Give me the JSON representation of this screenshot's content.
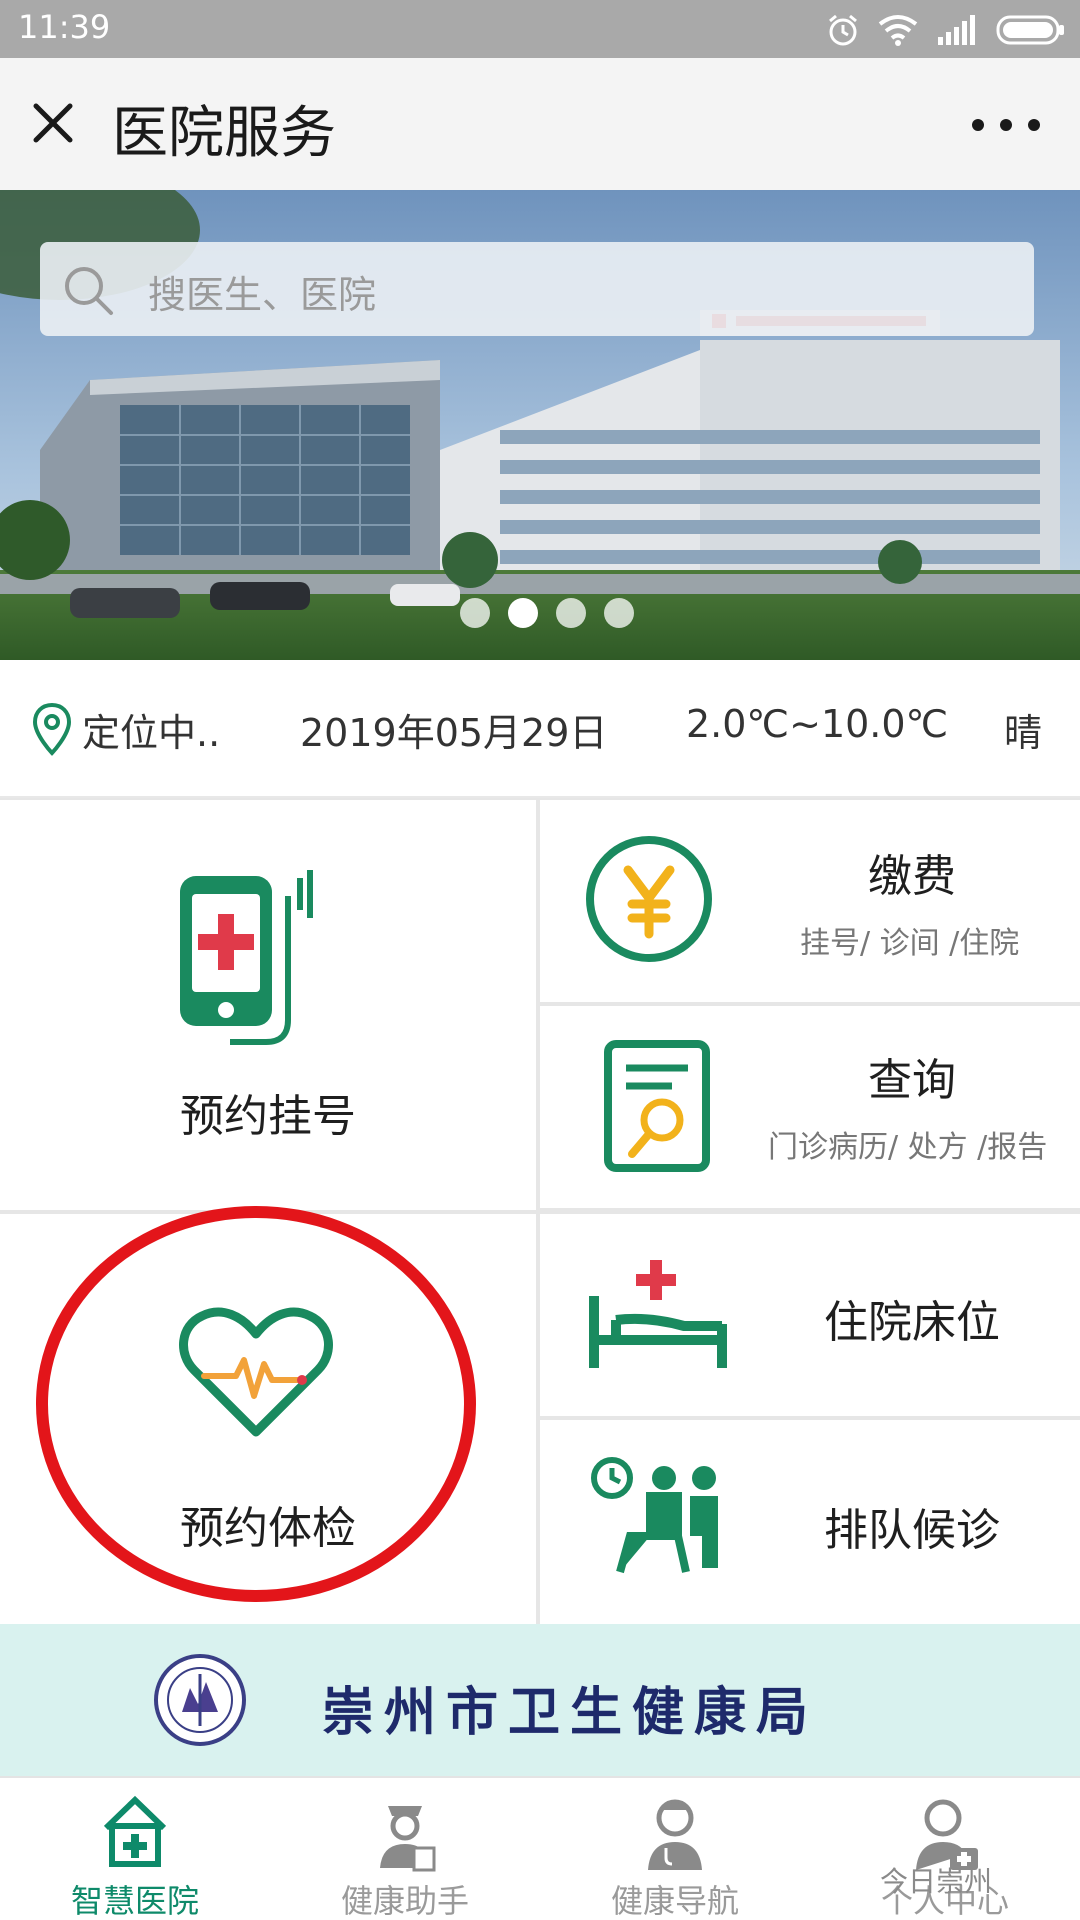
{
  "status_bar": {
    "time": "11:39"
  },
  "nav": {
    "title": "医院服务"
  },
  "search": {
    "placeholder": "搜医生、医院"
  },
  "info_row": {
    "location": "定位中..",
    "date": "2019年05月29日",
    "temperature": "2.0℃~10.0℃",
    "weather": "晴"
  },
  "services": {
    "appointment": {
      "label": "预约挂号"
    },
    "payment": {
      "label": "缴费",
      "sub": "挂号/ 诊间 /住院"
    },
    "query": {
      "label": "查询",
      "sub": "门诊病历/ 处方 /报告"
    },
    "checkup": {
      "label": "预约体检"
    },
    "bed": {
      "label": "住院床位"
    },
    "queue": {
      "label": "排队候诊"
    }
  },
  "footer_banner": {
    "name": "崇州市卫生健康局"
  },
  "tabs": [
    {
      "label": "智慧医院",
      "icon": "hospital-icon",
      "active": true
    },
    {
      "label": "健康助手",
      "icon": "nurse-icon",
      "active": false
    },
    {
      "label": "健康导航",
      "icon": "doctor-icon",
      "active": false
    },
    {
      "label": "个人中心",
      "icon": "user-icon",
      "active": false
    }
  ],
  "watermark": "今日崇州",
  "colors": {
    "brand_green": "#1a8a5f",
    "accent_red": "#e03a4a",
    "accent_yellow": "#f2b21b",
    "annotation_red": "#e3151a"
  }
}
